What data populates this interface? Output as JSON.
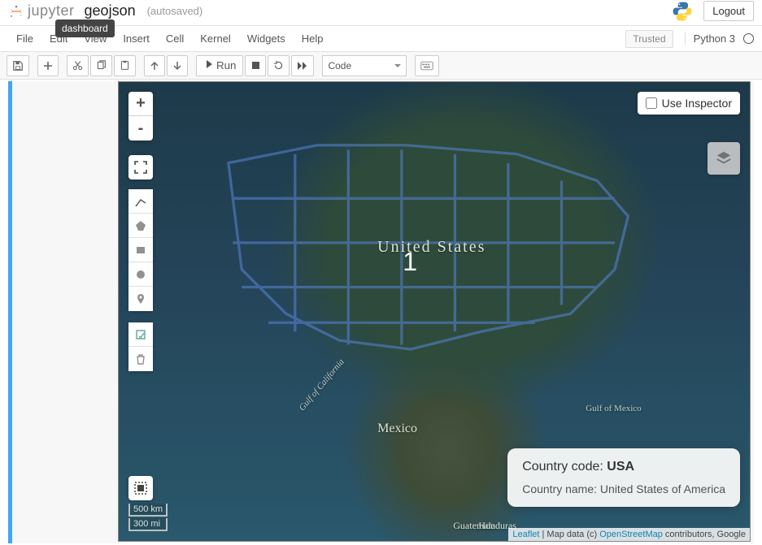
{
  "header": {
    "brand": "jupyter",
    "notebook_name": "geojson",
    "autosave": "(autosaved)",
    "logout": "Logout",
    "tooltip": "dashboard"
  },
  "menubar": {
    "items": [
      "File",
      "Edit",
      "View",
      "Insert",
      "Cell",
      "Kernel",
      "Widgets",
      "Help"
    ],
    "trusted": "Trusted",
    "kernel": "Python 3"
  },
  "toolbar": {
    "run_label": "Run",
    "celltype": "Code"
  },
  "map": {
    "labels": {
      "us": "United States",
      "mx": "Mexico",
      "gt": "Guatemala",
      "hn": "Honduras",
      "gulf_ca": "Gulf of California",
      "gulf_mx": "Gulf of Mexico"
    },
    "cluster_count": "1",
    "zoom_in": "+",
    "zoom_out": "-",
    "inspector_label": "Use Inspector",
    "inspector_checked": false,
    "popup": {
      "title_prefix": "Country code: ",
      "code": "USA",
      "body_prefix": "Country name: ",
      "name": "United States of America"
    },
    "scale": {
      "km": "500 km",
      "mi": "300 mi"
    },
    "attribution": {
      "leaflet": "Leaflet",
      "sep": " | Map data (c) ",
      "osm": "OpenStreetMap",
      "tail": " contributors, Google"
    }
  },
  "colors": {
    "cell_accent": "#42a5f5",
    "link": "#0078a8"
  }
}
